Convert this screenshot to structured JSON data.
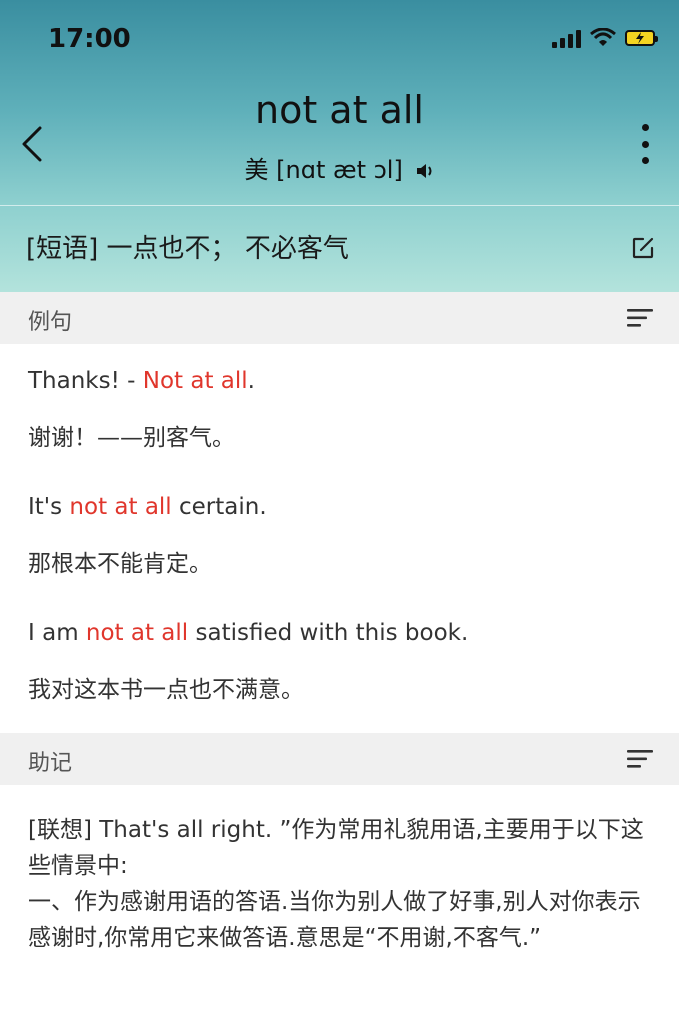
{
  "status": {
    "time": "17:00"
  },
  "header": {
    "word": "not at all",
    "pronunciation": "美 [nɑt æt ɔl]",
    "definition": "[短语] 一点也不； 不必客气"
  },
  "examples_section": {
    "label": "例句"
  },
  "examples": [
    {
      "en_before": "Thanks! - ",
      "en_highlight": "Not at all",
      "en_after": ".",
      "zh": "谢谢！——别客气。"
    },
    {
      "en_before": "It's ",
      "en_highlight": "not at all",
      "en_after": " certain.",
      "zh": "那根本不能肯定。"
    },
    {
      "en_before": "I am ",
      "en_highlight": "not at all",
      "en_after": " satisfied with this book.",
      "zh": "我对这本书一点也不满意。"
    }
  ],
  "mnemonic_section": {
    "label": "助记"
  },
  "mnemonic": {
    "text": "[联想] That's all right. ”作为常用礼貌用语,主要用于以下这些情景中:\n一、作为感谢用语的答语.当你为别人做了好事,别人对你表示感谢时,你常用它来做答语.意思是“不用谢,不客气.”"
  },
  "colors": {
    "highlight": "#e0362c",
    "header_top": "#3a8ea0",
    "header_bottom": "#b3e3dc"
  },
  "icons": [
    "back-icon",
    "more-icon",
    "speaker-icon",
    "edit-icon",
    "sort-icon",
    "signal-icon",
    "wifi-icon",
    "battery-icon"
  ]
}
